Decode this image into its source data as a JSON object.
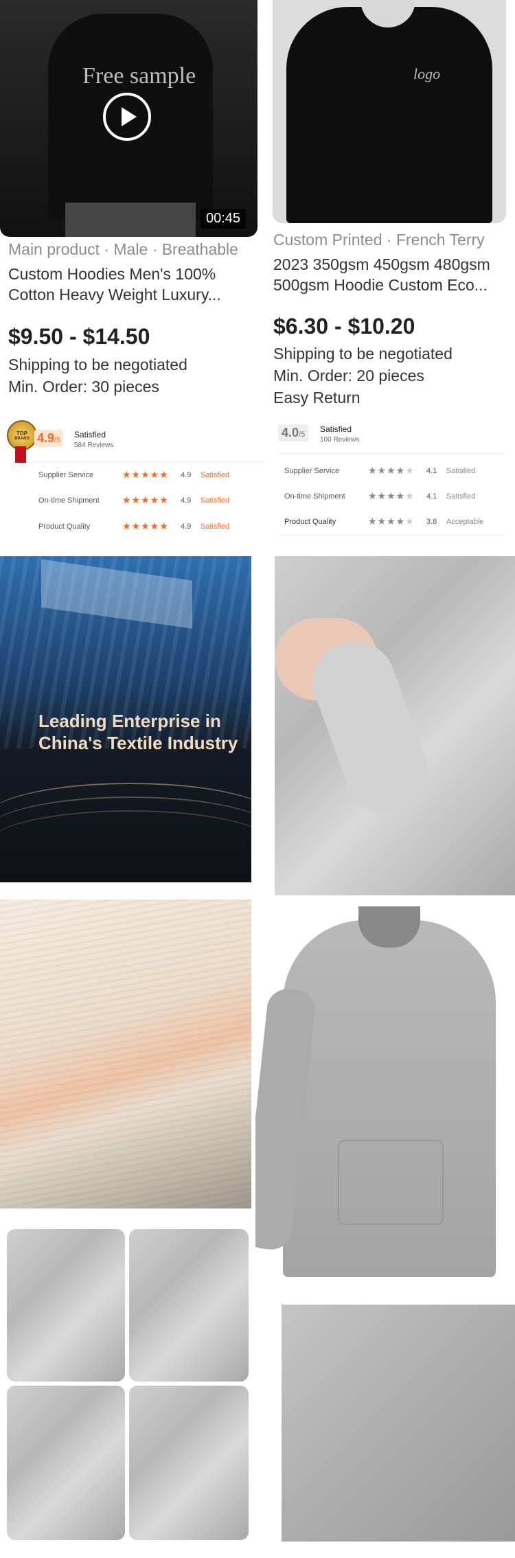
{
  "colors": {
    "accent": "#f36b21",
    "text": "#222222",
    "muted": "#8c8c8c"
  },
  "left_product": {
    "image_overlay": "Free sample",
    "duration": "00:45",
    "tags": "Main product · Male · Breathable",
    "title": "Custom Hoodies Men's 100% Cotton Heavy Weight Luxury...",
    "price": "$9.50 - $14.50",
    "shipping": "Shipping to be negotiated",
    "min_order": "Min. Order: 30 pieces",
    "badge_top": "TOP",
    "badge_brand": "BRAND",
    "score": "4.9",
    "score_suffix": "/5",
    "rating_label": "Satisfied",
    "reviews": "584 Reviews",
    "metrics": [
      {
        "name": "Supplier Service",
        "value": "4.9",
        "label": "Satisfied",
        "stars": 5
      },
      {
        "name": "On-time Shipment",
        "value": "4.9",
        "label": "Satisfied",
        "stars": 5
      },
      {
        "name": "Product Quality",
        "value": "4.9",
        "label": "Satisfied",
        "stars": 5
      }
    ]
  },
  "right_product": {
    "image_overlay": "logo",
    "tags": "Custom Printed · French Terry",
    "title": "2023 350gsm 450gsm 480gsm 500gsm Hoodie Custom Eco...",
    "price": "$6.30 - $10.20",
    "shipping": "Shipping to be negotiated",
    "min_order": "Min. Order: 20 pieces",
    "return": "Easy Return",
    "score": "4.0",
    "score_suffix": "/5",
    "rating_label": "Satisfied",
    "reviews": "100 Reviews",
    "metrics": [
      {
        "name": "Supplier Service",
        "value": "4.1",
        "label": "Satisfied",
        "stars": 4
      },
      {
        "name": "On-time Shipment",
        "value": "4.1",
        "label": "Satisfied",
        "stars": 4
      },
      {
        "name": "Product Quality",
        "value": "3.8",
        "label": "Acceptable",
        "stars": 4
      }
    ]
  },
  "banner": {
    "line1": "Leading Enterprise in",
    "line2": "China's Textile Industry"
  }
}
